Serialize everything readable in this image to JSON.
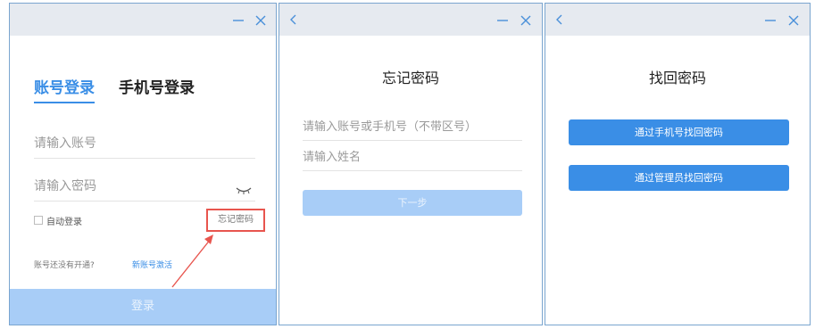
{
  "login_panel": {
    "tabs": [
      "账号登录",
      "手机号登录"
    ],
    "account_placeholder": "请输入账号",
    "password_placeholder": "请输入密码",
    "auto_login_label": "自动登录",
    "forgot_label": "忘记密码",
    "signup_prompt": "账号还没有开通?",
    "signup_link": "新账号激活",
    "login_button": "登录",
    "annotation_color": "#e8554e"
  },
  "forgot_panel": {
    "title": "忘记密码",
    "account_placeholder": "请输入账号或手机号（不带区号）",
    "name_placeholder": "请输入姓名",
    "next_button": "下一步"
  },
  "recover_panel": {
    "title": "找回密码",
    "by_phone_button": "通过手机号找回密码",
    "by_admin_button": "通过管理员找回密码"
  },
  "colors": {
    "accent": "#3a8ee6",
    "disabled_button": "#a8cdf7",
    "titlebar": "#e6eaf0",
    "window_border": "#7aa5cf"
  },
  "icons": {
    "back": "chevron-left-icon",
    "minimize": "minimize-icon",
    "close": "close-icon",
    "password_visibility": "eye-closed-icon"
  }
}
